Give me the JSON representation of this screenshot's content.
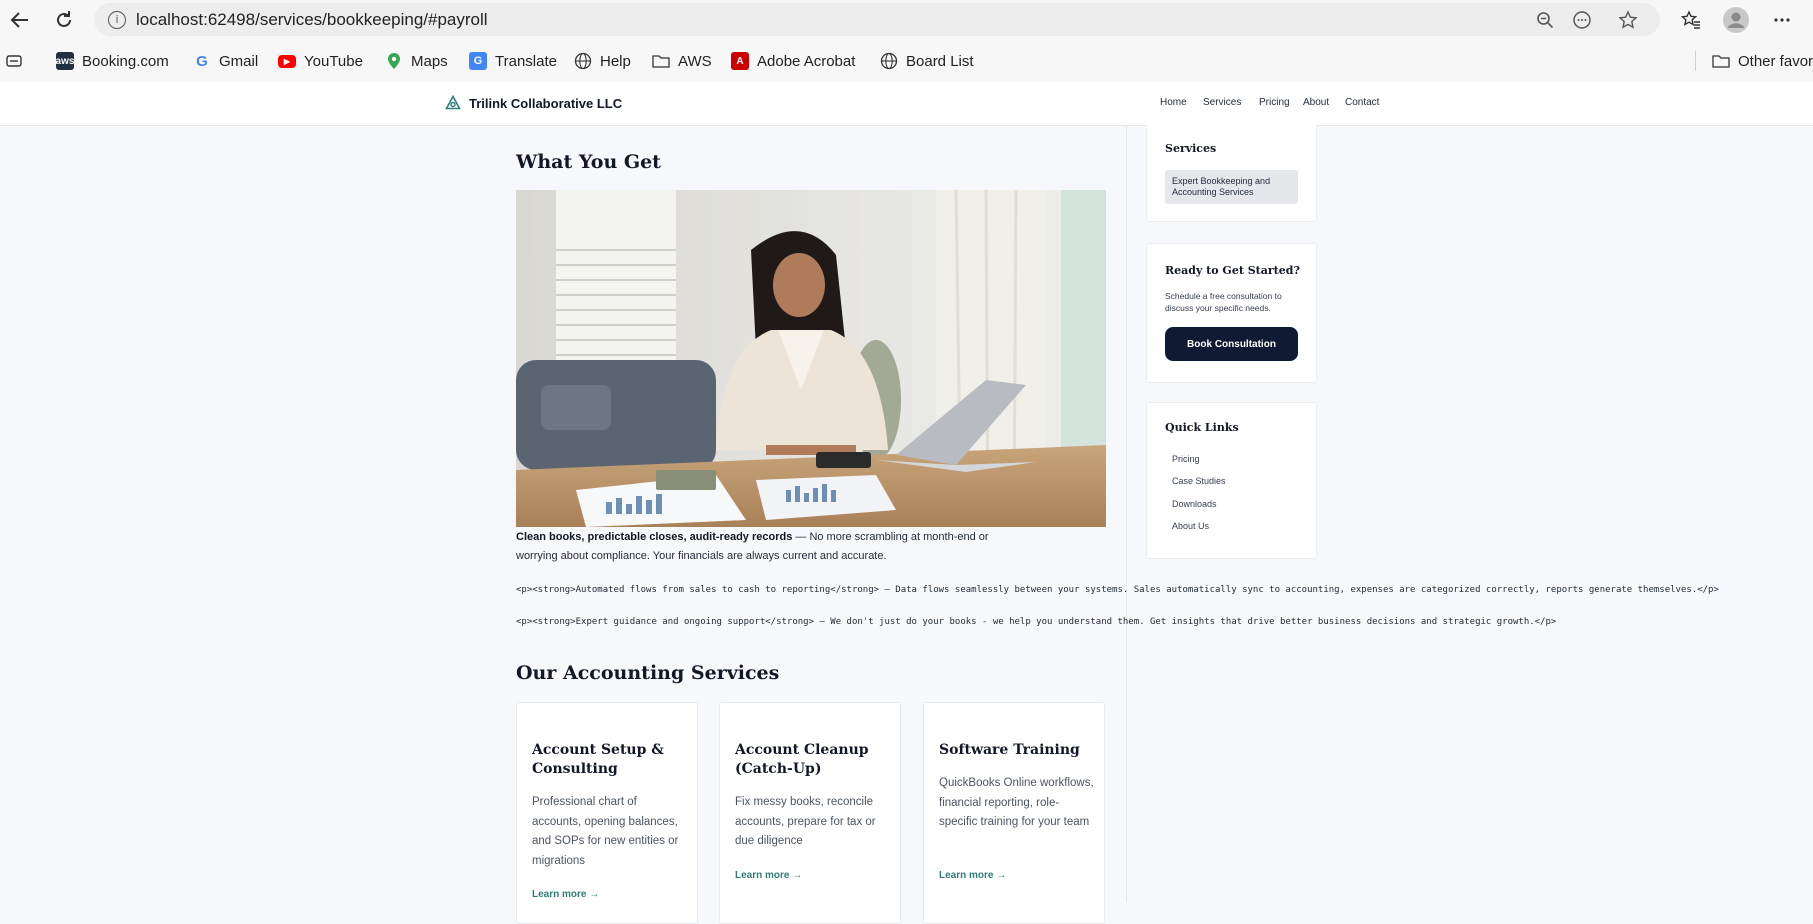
{
  "browser": {
    "url": "localhost:62498/services/bookkeeping/#payroll",
    "bookmarks": [
      "Booking.com",
      "Gmail",
      "YouTube",
      "Maps",
      "Translate",
      "Help",
      "AWS",
      "Adobe Acrobat",
      "Board List"
    ],
    "other_favorites": "Other favori"
  },
  "site": {
    "brand": "Trilink Collaborative LLC",
    "nav": [
      "Home",
      "Services",
      "Pricing",
      "About",
      "Contact"
    ]
  },
  "main": {
    "what_you_get_title": "What You Get",
    "para1_strong": "Clean books, predictable closes, audit-ready records",
    "para1_rest": " — No more scrambling at month-end or worrying about compliance. Your financials are always current and accurate.",
    "raw_line1": "<p><strong>Automated flows from sales to cash to reporting</strong> — Data flows seamlessly between your systems. Sales automatically sync to accounting, expenses are categorized correctly, reports generate themselves.</p>",
    "raw_line2": "<p><strong>Expert guidance and ongoing support</strong> — We don't just do your books - we help you understand them. Get insights that drive better business decisions and strategic growth.</p>",
    "services_title": "Our Accounting Services",
    "cards": [
      {
        "title": "Account Setup & Consulting",
        "desc": "Professional chart of accounts, opening balances, and SOPs for new entities or migrations",
        "link": "Learn more →"
      },
      {
        "title": "Account Cleanup (Catch-Up)",
        "desc": "Fix messy books, reconcile accounts, prepare for tax or due diligence",
        "link": "Learn more →"
      },
      {
        "title": "Software Training",
        "desc": "QuickBooks Online workflows, financial reporting, role-specific training for your team",
        "link": "Learn more →"
      }
    ]
  },
  "sidebar": {
    "services_title": "Services",
    "services_item": "Expert Bookkeeping and Accounting Services",
    "cta_title": "Ready to Get Started?",
    "cta_text": "Schedule a free consultation to discuss your specific needs.",
    "cta_button": "Book Consultation",
    "quick_links_title": "Quick Links",
    "quick_links": [
      "Pricing",
      "Case Studies",
      "Downloads",
      "About Us"
    ]
  }
}
